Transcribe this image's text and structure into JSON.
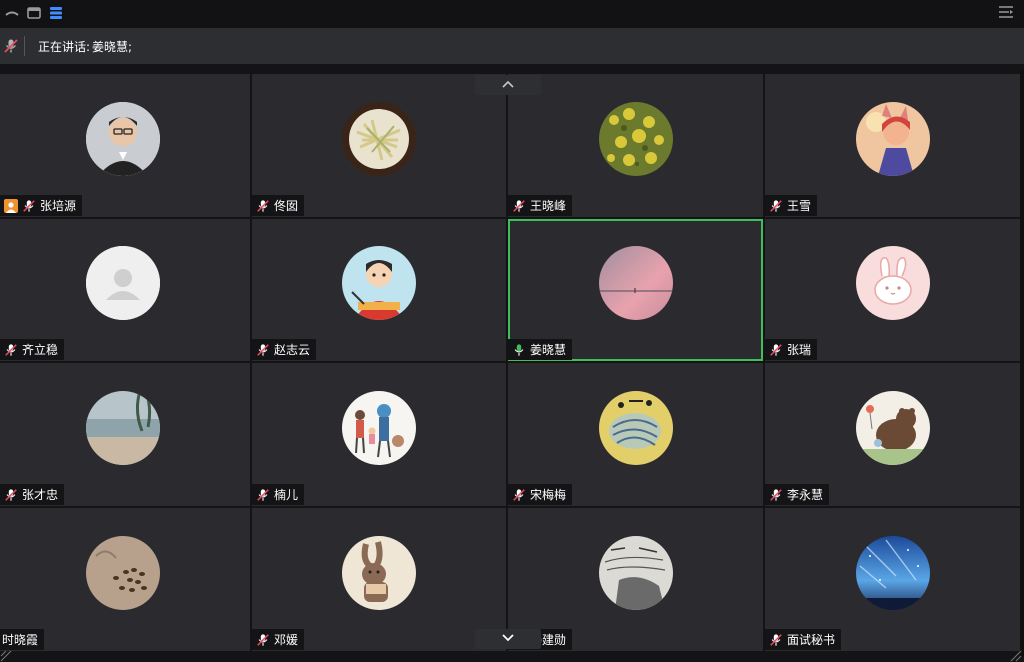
{
  "speaking": {
    "label": "正在讲话:",
    "name": "姜晓慧;"
  },
  "colors": {
    "active_border": "#3dbf5c",
    "mic_muted": "#e84a5f",
    "mic_on": "#3dbf5c",
    "host_badge": "#f0922f"
  },
  "participants": [
    {
      "name": "张培源",
      "mic": "muted",
      "host": true,
      "avatar": "photo-man"
    },
    {
      "name": "佟囡",
      "mic": "muted",
      "avatar": "food"
    },
    {
      "name": "王晓峰",
      "mic": "muted",
      "avatar": "yellow-flowers"
    },
    {
      "name": "王雪",
      "mic": "muted",
      "avatar": "cartoon-girl"
    },
    {
      "name": "齐立稳",
      "mic": "muted",
      "avatar": "default-user"
    },
    {
      "name": "赵志云",
      "mic": "muted",
      "avatar": "cartoon-boy"
    },
    {
      "name": "姜晓慧",
      "mic": "on",
      "active": true,
      "avatar": "pink-sky"
    },
    {
      "name": "张瑞",
      "mic": "muted",
      "avatar": "bunny"
    },
    {
      "name": "张才忠",
      "mic": "muted",
      "avatar": "beach"
    },
    {
      "name": "楠儿",
      "mic": "muted",
      "avatar": "family"
    },
    {
      "name": "宋梅梅",
      "mic": "muted",
      "avatar": "painting"
    },
    {
      "name": "李永慧",
      "mic": "muted",
      "avatar": "bear"
    },
    {
      "name": "时晓霞",
      "mic": "none",
      "avatar": "beans"
    },
    {
      "name": "邓媛",
      "mic": "muted",
      "avatar": "rabbit"
    },
    {
      "name": "姜建勋",
      "mic": "muted",
      "avatar": "sketch"
    },
    {
      "name": "面试秘书",
      "mic": "muted",
      "avatar": "night-sky"
    }
  ]
}
